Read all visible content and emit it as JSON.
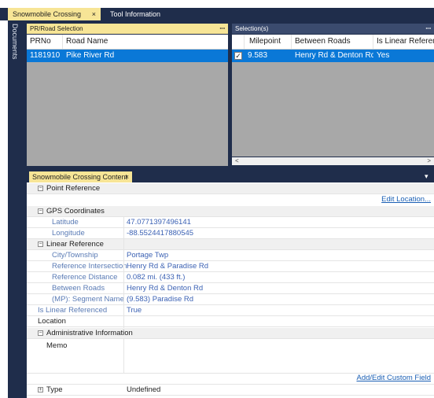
{
  "doc_tabs": [
    {
      "label": "Snowmobile Crossing",
      "close": "×"
    },
    {
      "label": "Tool Information"
    }
  ],
  "sidebar": {
    "label": "Documents"
  },
  "road_panel": {
    "title": "PR/Road Selection",
    "pin": "ꟷ",
    "columns": [
      "PRNo",
      "Road Name"
    ],
    "rows": [
      [
        "1181910",
        "Pike River Rd"
      ]
    ]
  },
  "selection_panel": {
    "title": "Selection(s)",
    "pin": "ꟷ",
    "columns": [
      "Milepoint",
      "Between Roads",
      "Is Linear Reference"
    ],
    "rows": [
      {
        "checked": true,
        "check_glyph": "✓",
        "milepoint": "9.583",
        "between": "Henry Rd & Denton Rd",
        "linear": "Yes"
      }
    ],
    "scroll_left": "<",
    "scroll_right": ">"
  },
  "content": {
    "tab_label": "Snowmobile Crossing Content",
    "tab_close": "×",
    "tab_menu": "▾",
    "point_reference": "Point Reference",
    "edit_location": "Edit Location...",
    "gps": "GPS Coordinates",
    "latitude_label": "Latitude",
    "latitude_value": "47.0771397496141",
    "longitude_label": "Longitude",
    "longitude_value": "-88.5524417880545",
    "linear_reference": "Linear Reference",
    "city_label": "City/Township",
    "city_value": "Portage Twp",
    "ref_int_label": "Reference Intersection",
    "ref_int_value": "Henry Rd & Paradise Rd",
    "ref_dist_label": "Reference Distance",
    "ref_dist_value": "0.082 mi. (433 ft.)",
    "between_label": "Between Roads",
    "between_value": "Henry Rd & Denton Rd",
    "segment_label": "(MP): Segment Name",
    "segment_value": "(9.583) Paradise Rd",
    "is_linear_label": "Is Linear Referenced",
    "is_linear_value": "True",
    "location_label": "Location",
    "admin": "Administrative Information",
    "memo_label": "Memo",
    "custom_field_link": "Add/Edit Custom Field",
    "type_label": "Type",
    "type_value": "Undefined",
    "minus": "−",
    "plus": "+"
  }
}
